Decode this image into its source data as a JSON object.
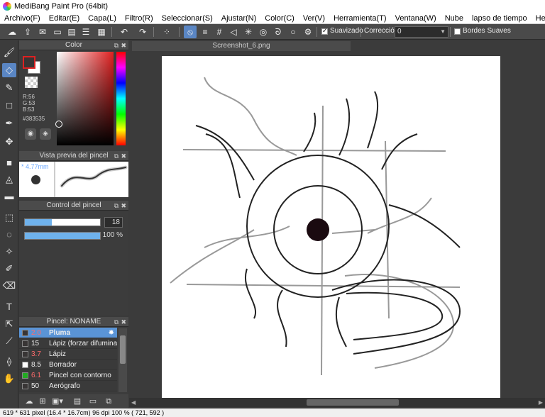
{
  "window": {
    "title": "MediBang Paint Pro (64bit)"
  },
  "menu": [
    "Archivo(F)",
    "Editar(E)",
    "Capa(L)",
    "Filtro(R)",
    "Seleccionar(S)",
    "Ajustar(N)",
    "Color(C)",
    "Ver(V)",
    "Herramienta(T)",
    "Ventana(W)",
    "Nube",
    "lapso de tiempo",
    "Help"
  ],
  "toolbar": {
    "antialias_label": "Suavizado",
    "antialias_checked": true,
    "correction_label": "Corrección",
    "correction_value": "0",
    "soft_edges_label": "Bordes Suaves",
    "soft_edges_checked": false
  },
  "color_panel": {
    "title": "Color",
    "r": "R:56",
    "g": "G:53",
    "b": "B:53",
    "hex": "#383535",
    "foreground": "#383535",
    "background": "#ffffff"
  },
  "brush_preview": {
    "title": "Vista previa del pincel",
    "size": "* 4.77mm"
  },
  "brush_control": {
    "title": "Control del pincel",
    "size_value": "18",
    "opacity_value": "100 %",
    "size_fraction": 0.36,
    "opacity_fraction": 1.0
  },
  "brush_panel": {
    "title": "Pincel: NONAME",
    "items": [
      {
        "size": "2.0",
        "name": "Pluma",
        "color": "#383535",
        "selected": true,
        "size_color": "#ff6b6b"
      },
      {
        "size": "15",
        "name": "Lápiz (forzar difuminado)",
        "color": "#383535",
        "selected": false,
        "size_color": "#eeeeee"
      },
      {
        "size": "3.7",
        "name": "Lápiz",
        "color": "#383535",
        "selected": false,
        "size_color": "#ff6b6b"
      },
      {
        "size": "8.5",
        "name": "Borrador",
        "color": "#ffffff",
        "selected": false,
        "size_color": "#eeeeee"
      },
      {
        "size": "6.1",
        "name": "Pincel con contorno",
        "color": "#22aa22",
        "selected": false,
        "size_color": "#ff6b6b"
      },
      {
        "size": "50",
        "name": "Aerógrafo",
        "color": "#383535",
        "selected": false,
        "size_color": "#eeeeee"
      }
    ]
  },
  "document": {
    "tab_title": "Screenshot_6.png"
  },
  "status": {
    "text": "619 * 631 pixel   (16.4 * 16.7cm)   96 dpi   100 %   ( 721, 592 )"
  }
}
